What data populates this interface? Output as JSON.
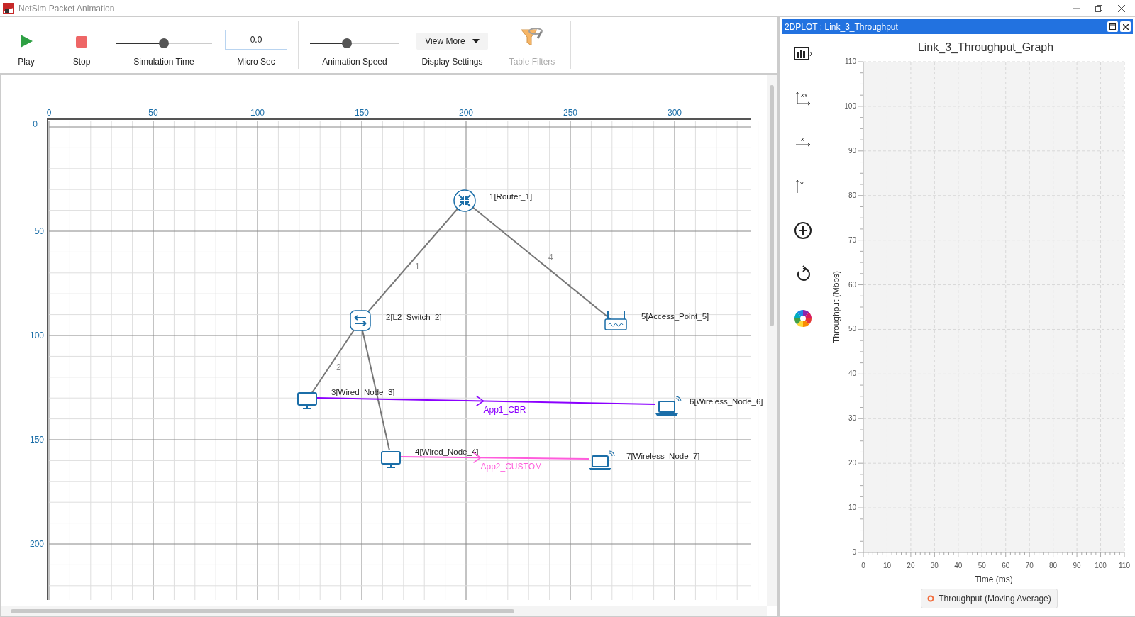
{
  "window": {
    "title": "NetSim Packet Animation"
  },
  "toolbar": {
    "play": "Play",
    "stop": "Stop",
    "simulation_time": {
      "label": "Simulation Time",
      "level": 0.5
    },
    "time_field": {
      "value": "0.0",
      "label": "Micro Sec"
    },
    "animation_speed": {
      "label": "Animation Speed",
      "level": 0.41
    },
    "view_more": "View More",
    "display_settings": "Display Settings",
    "table_filters": {
      "label": "Table Filters",
      "disabled": true
    }
  },
  "canvas": {
    "x_axis": [
      "0",
      "50",
      "100",
      "150",
      "200",
      "250",
      "300"
    ],
    "y_axis": [
      "0",
      "50",
      "100",
      "150",
      "200"
    ],
    "nodes": [
      {
        "label": "1[Router_1]",
        "kind": "router"
      },
      {
        "label": "2[L2_Switch_2]",
        "kind": "switch"
      },
      {
        "label": "3[Wired_Node_3]",
        "kind": "desktop"
      },
      {
        "label": "4[Wired_Node_4]",
        "kind": "desktop"
      },
      {
        "label": "5[Access_Point_5]",
        "kind": "access_point"
      },
      {
        "label": "6[Wireless_Node_6]",
        "kind": "laptop"
      },
      {
        "label": "7[Wireless_Node_7]",
        "kind": "laptop"
      }
    ],
    "links": [
      {
        "label": "1"
      },
      {
        "label": "4"
      },
      {
        "label": "2"
      }
    ],
    "applications": [
      {
        "label": "App1_CBR",
        "color": "#8b00ff"
      },
      {
        "label": "App2_CUSTOM",
        "color": "#ff5cdc"
      }
    ]
  },
  "plot": {
    "title": "2DPLOT : Link_3_Throughput",
    "axis_tools": [
      "XY",
      "X",
      "Y"
    ],
    "chart_data": {
      "type": "line",
      "title": "Link_3_Throughput_Graph",
      "xlabel": "Time (ms)",
      "ylabel": "Throughput (Mbps)",
      "categories": [
        "0",
        "10",
        "20",
        "30",
        "40",
        "50",
        "60",
        "70",
        "80",
        "90",
        "100",
        "110"
      ],
      "ylim": [
        0,
        110
      ],
      "grid": true,
      "yticks": [
        0,
        10,
        20,
        30,
        40,
        50,
        60,
        70,
        80,
        90,
        100,
        110
      ],
      "series": [
        {
          "name": "Throughput (Moving Average)",
          "color": "#f26b3a",
          "values": [
            null,
            null,
            null,
            null,
            null,
            null,
            null,
            null,
            null,
            null,
            null,
            null
          ]
        }
      ]
    }
  }
}
